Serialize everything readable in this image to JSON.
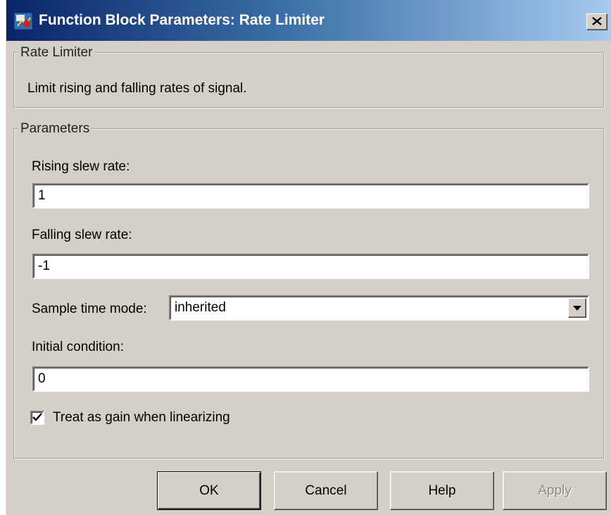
{
  "window": {
    "title": "Function Block Parameters: Rate Limiter",
    "icon": "simulink-block-icon",
    "close_icon": "close-icon"
  },
  "block_group": {
    "legend": "Rate Limiter",
    "description": "Limit rising and falling rates of signal."
  },
  "parameters": {
    "legend": "Parameters",
    "rising_slew_rate": {
      "label": "Rising slew rate:",
      "value": "1"
    },
    "falling_slew_rate": {
      "label": "Falling slew rate:",
      "value": "-1"
    },
    "sample_time_mode": {
      "label": "Sample time mode:",
      "value": "inherited",
      "icon": "chevron-down-icon"
    },
    "initial_condition": {
      "label": "Initial condition:",
      "value": "0"
    },
    "treat_as_gain": {
      "label": "Treat as gain when linearizing",
      "checked": true
    }
  },
  "buttons": {
    "ok": "OK",
    "cancel": "Cancel",
    "help": "Help",
    "apply": "Apply"
  },
  "colors": {
    "face": "#d4d0c8",
    "title_start": "#0a246a",
    "title_end": "#a6caf0"
  }
}
